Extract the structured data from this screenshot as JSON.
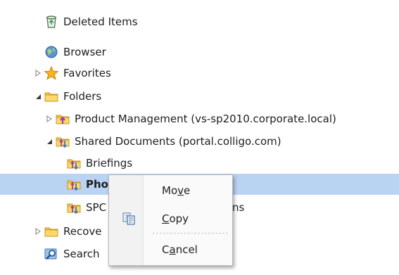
{
  "tree": {
    "deleted_items": "Deleted Items",
    "browser": "Browser",
    "favorites": "Favorites",
    "folders": "Folders",
    "product_management": "Product Management (vs-sp2010.corporate.local)",
    "shared_documents": "Shared Documents (portal.colligo.com)",
    "briefings": "Briefings",
    "photos_visible": "Pho",
    "spc_visible_start": "SPC",
    "spc_visible_end": "ns",
    "recovered_visible": "Recove",
    "search_visible": "Search"
  },
  "context_menu": {
    "move_pre": "Mo",
    "move_u": "v",
    "move_post": "e",
    "copy_u": "C",
    "copy_post": "opy",
    "cancel_pre": "C",
    "cancel_u": "a",
    "cancel_post": "ncel"
  },
  "colors": {
    "selection": "#b9d3f3",
    "folder": "#f2c64b",
    "accent_blue": "#2f7bd5"
  }
}
